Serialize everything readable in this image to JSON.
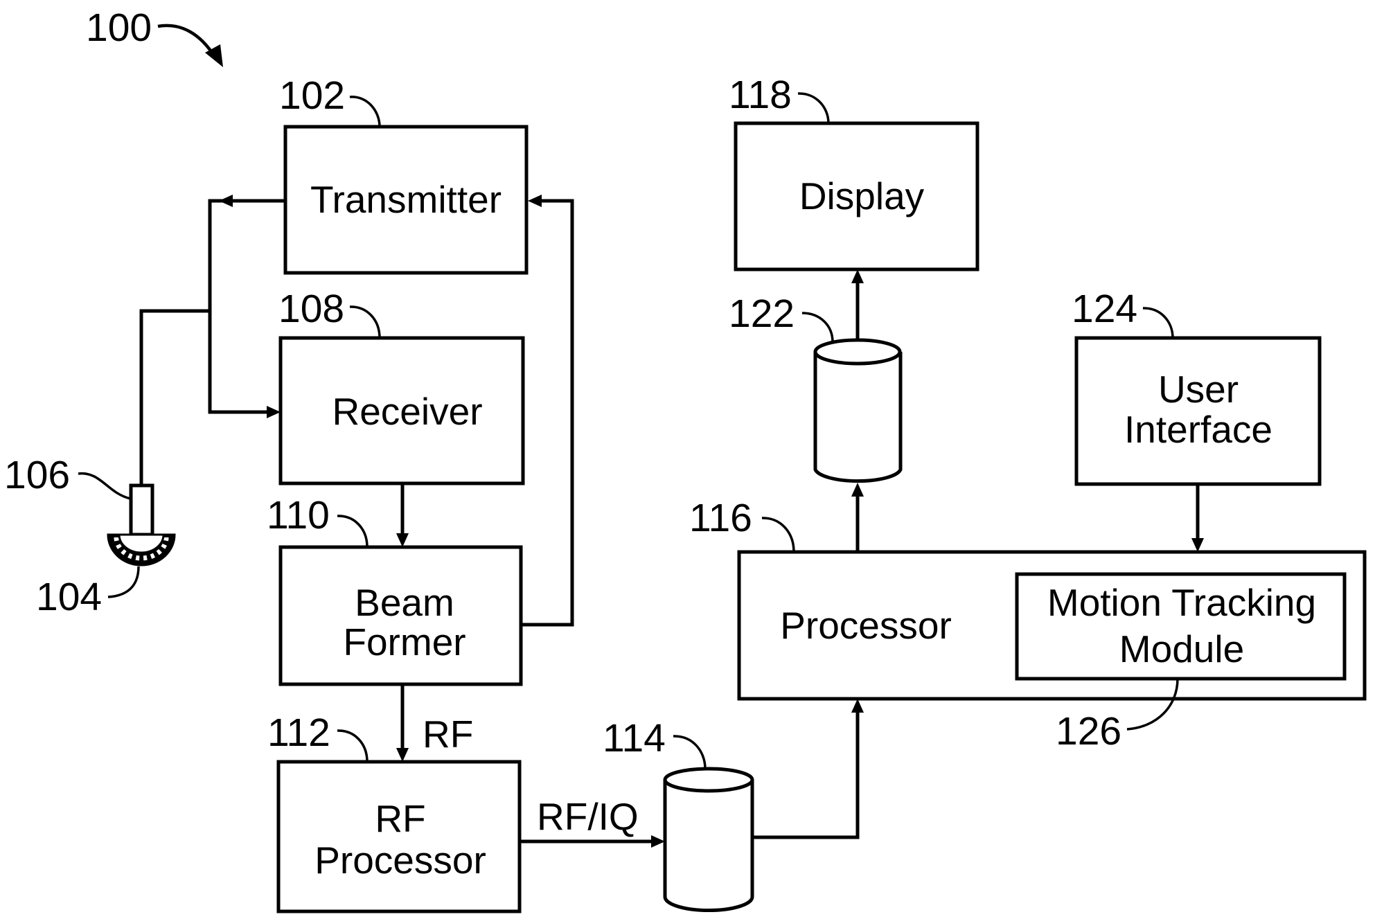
{
  "figure": {
    "reference": "100",
    "blocks": {
      "transmitter": {
        "ref": "102",
        "label": "Transmitter"
      },
      "receiver": {
        "ref": "108",
        "label": "Receiver"
      },
      "beam_former": {
        "ref": "110",
        "label_line1": "Beam",
        "label_line2": "Former"
      },
      "rf_processor": {
        "ref": "112",
        "label_line1": "RF",
        "label_line2": "Processor"
      },
      "rf_iq_buffer": {
        "ref": "114"
      },
      "processor": {
        "ref": "116",
        "label": "Processor"
      },
      "display": {
        "ref": "118",
        "label": "Display"
      },
      "image_buffer": {
        "ref": "122"
      },
      "user_interface": {
        "ref": "124",
        "label_line1": "User",
        "label_line2": "Interface"
      },
      "motion_tracking_module": {
        "ref": "126",
        "label_line1": "Motion Tracking",
        "label_line2": "Module"
      },
      "probe": {
        "ref": "106"
      },
      "transducer_elements": {
        "ref": "104"
      }
    },
    "signals": {
      "beamformer_to_rf": "RF",
      "rf_to_buffer": "RF/IQ"
    }
  }
}
